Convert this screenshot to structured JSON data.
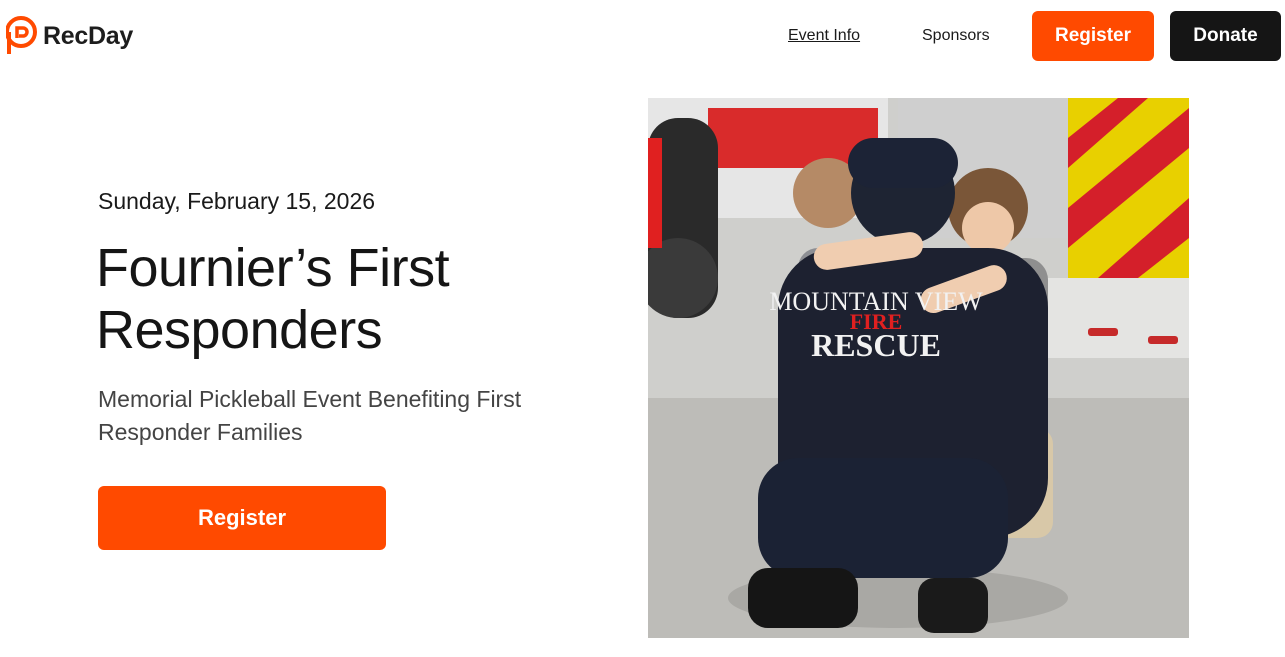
{
  "header": {
    "logo_text": "RecDay",
    "logo_icon": "recday-logo-icon",
    "nav": [
      {
        "label": "Event Info",
        "active": true
      },
      {
        "label": "Sponsors",
        "active": false
      }
    ],
    "register_label": "Register",
    "donate_label": "Donate"
  },
  "hero": {
    "date": "Sunday, February 15, 2026",
    "title": "Fournier’s First Responders",
    "subtitle": "Memorial Pickleball Event Benefiting First Responder Families",
    "register_label": "Register",
    "image": {
      "shirt_line1": "MOUNTAIN VIEW",
      "shirt_line2": "FIRE",
      "shirt_line3": "RESCUE"
    }
  },
  "colors": {
    "accent": "#ff4a00",
    "dark": "#151515",
    "subtitle": "#444444"
  }
}
